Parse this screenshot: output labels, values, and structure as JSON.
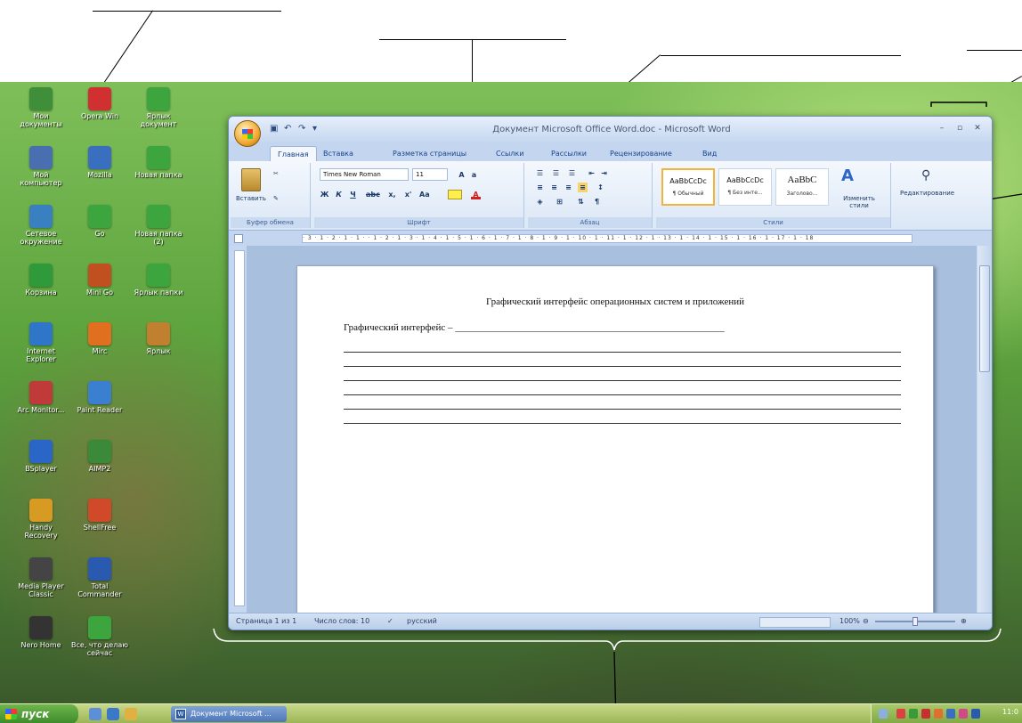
{
  "desktop_icons": [
    {
      "label": "Мои документы",
      "color": "#3f8f3a"
    },
    {
      "label": "Мой компьютер",
      "color": "#4a6fb0"
    },
    {
      "label": "Сетевое окружение",
      "color": "#3a7fc0"
    },
    {
      "label": "Корзина",
      "color": "#2e9a3a"
    },
    {
      "label": "Internet Explorer",
      "color": "#2f76c8"
    },
    {
      "label": "Arc Monitor...",
      "color": "#c03a3a"
    },
    {
      "label": "BSplayer",
      "color": "#2a66c8"
    },
    {
      "label": "Handy Recovery",
      "color": "#d79a22"
    },
    {
      "label": "Media Player Classic",
      "color": "#444"
    },
    {
      "label": "Nero Home",
      "color": "#333"
    },
    {
      "label": "Opera Win",
      "color": "#d03030"
    },
    {
      "label": "Mozilla",
      "color": "#3a6fc0"
    },
    {
      "label": "Go",
      "color": "#3da53d"
    },
    {
      "label": "Mini Go",
      "color": "#c05020"
    },
    {
      "label": "Mirc",
      "color": "#e07020"
    },
    {
      "label": "Paint Reader",
      "color": "#3a7fd0"
    },
    {
      "label": "AIMP2",
      "color": "#3a8a3a"
    },
    {
      "label": "ShellFree",
      "color": "#d04a2a"
    },
    {
      "label": "Total Commander",
      "color": "#2a5ab0"
    },
    {
      "label": "Все, что делаю сейчас",
      "color": "#3da53d"
    },
    {
      "label": "Ярлык документ",
      "color": "#3da53d"
    },
    {
      "label": "Новая папка",
      "color": "#3da53d"
    },
    {
      "label": "Новая папка (2)",
      "color": "#3da53d"
    },
    {
      "label": "Ярлык папки",
      "color": "#3da53d"
    },
    {
      "label": "Ярлык",
      "color": "#c08030"
    }
  ],
  "taskbar": {
    "start_label": "пуск",
    "task_button": "Документ Microsoft ...",
    "clock": "11:0"
  },
  "word": {
    "title": "Документ Microsoft Office Word.doc - Microsoft Word",
    "tabs": [
      "Главная",
      "Вставка",
      "Разметка страницы",
      "Ссылки",
      "Рассылки",
      "Рецензирование",
      "Вид"
    ],
    "ribbon": {
      "clipboard_group": "Буфер обмена",
      "paste_label": "Вставить",
      "font_group": "Шрифт",
      "font_name": "Times New Roman",
      "font_size": "11",
      "paragraph_group": "Абзац",
      "styles_group": "Стили",
      "styles": [
        {
          "sample": "AaBbCcDc",
          "name": "¶ Обычный"
        },
        {
          "sample": "AaBbCcDc",
          "name": "¶ Без инте..."
        },
        {
          "sample": "AaBbC",
          "name": "Заголово..."
        }
      ],
      "change_styles": "Изменить стили",
      "editing": "Редактирование"
    },
    "ruler_text": "· 3 · 1 · 2 · 1 · 1 · · 1 · 2 · 1 · 3 · 1 · 4 · 1 · 5 · 1 · 6 · 1 · 7 · 1 · 8 · 1 · 9 · 1 · 10 · 1 · 11 · 1 · 12 · 1 · 13 · 1 · 14 · 1 · 15 · 1 · 16 · 1 · 17 · 1 · 18",
    "document": {
      "heading": "Графический интерфейс операционных систем и приложений",
      "line1": "Графический интерфейс – _______________________________________________________"
    },
    "status": {
      "page": "Страница 1 из 1",
      "words": "Число слов: 10",
      "language": "русский",
      "zoom": "100%"
    }
  }
}
